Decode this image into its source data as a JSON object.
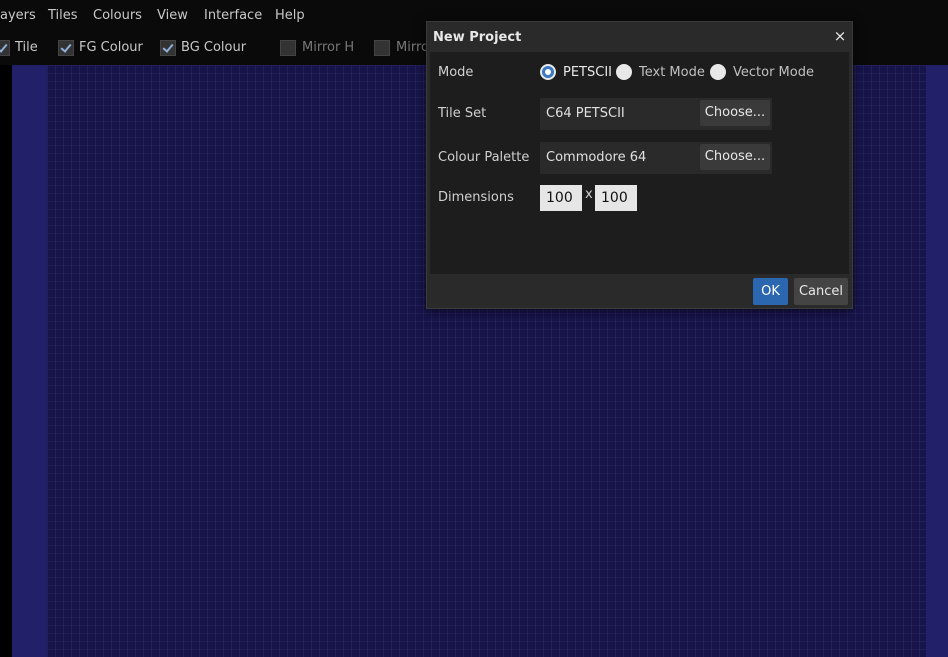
{
  "menubar": {
    "items": [
      "ayers",
      "Tiles",
      "Colours",
      "View",
      "Interface",
      "Help"
    ]
  },
  "toolbar": {
    "items": [
      {
        "label": "Tile",
        "checked": true
      },
      {
        "label": "FG Colour",
        "checked": true
      },
      {
        "label": "BG Colour",
        "checked": true
      },
      {
        "label": "Mirror H",
        "checked": false
      },
      {
        "label": "Mirro",
        "checked": false
      }
    ]
  },
  "dialog": {
    "title": "New Project",
    "close_glyph": "×",
    "mode": {
      "label": "Mode",
      "options": [
        "PETSCII",
        "Text Mode",
        "Vector Mode"
      ],
      "selected": "PETSCII"
    },
    "tileset": {
      "label": "Tile Set",
      "value": "C64 PETSCII",
      "button": "Choose..."
    },
    "palette": {
      "label": "Colour Palette",
      "value": "Commodore 64",
      "button": "Choose..."
    },
    "dimensions": {
      "label": "Dimensions",
      "width": "100",
      "separator": "x",
      "height": "100"
    },
    "ok_label": "OK",
    "cancel_label": "Cancel"
  },
  "colors": {
    "canvas_bg": "#17144a",
    "canvas_border": "#23206a",
    "accent": "#2a67b0"
  }
}
